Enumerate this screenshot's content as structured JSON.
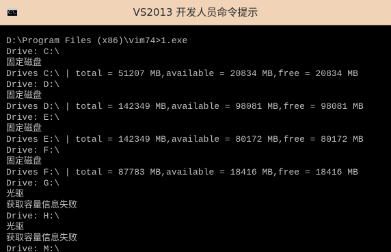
{
  "window": {
    "title": "VS2013 开发人员命令提示",
    "icon_text": "C:\\."
  },
  "console": {
    "lines": [
      "D:\\Program Files (x86)\\vim74>1.exe",
      "Drive: C:\\",
      "固定磁盘",
      "Drives C:\\ | total = 51207 MB,available = 20834 MB,free = 20834 MB",
      "Drive: D:\\",
      "固定磁盘",
      "Drives D:\\ | total = 142349 MB,available = 98081 MB,free = 98081 MB",
      "Drive: E:\\",
      "固定磁盘",
      "Drives E:\\ | total = 142349 MB,available = 80172 MB,free = 80172 MB",
      "Drive: F:\\",
      "固定磁盘",
      "Drives F:\\ | total = 87783 MB,available = 18416 MB,free = 18416 MB",
      "Drive: G:\\",
      "光驱",
      "获取容量信息失败",
      "Drive: H:\\",
      "光驱",
      "获取容量信息失败",
      "Drive: M:\\"
    ]
  }
}
